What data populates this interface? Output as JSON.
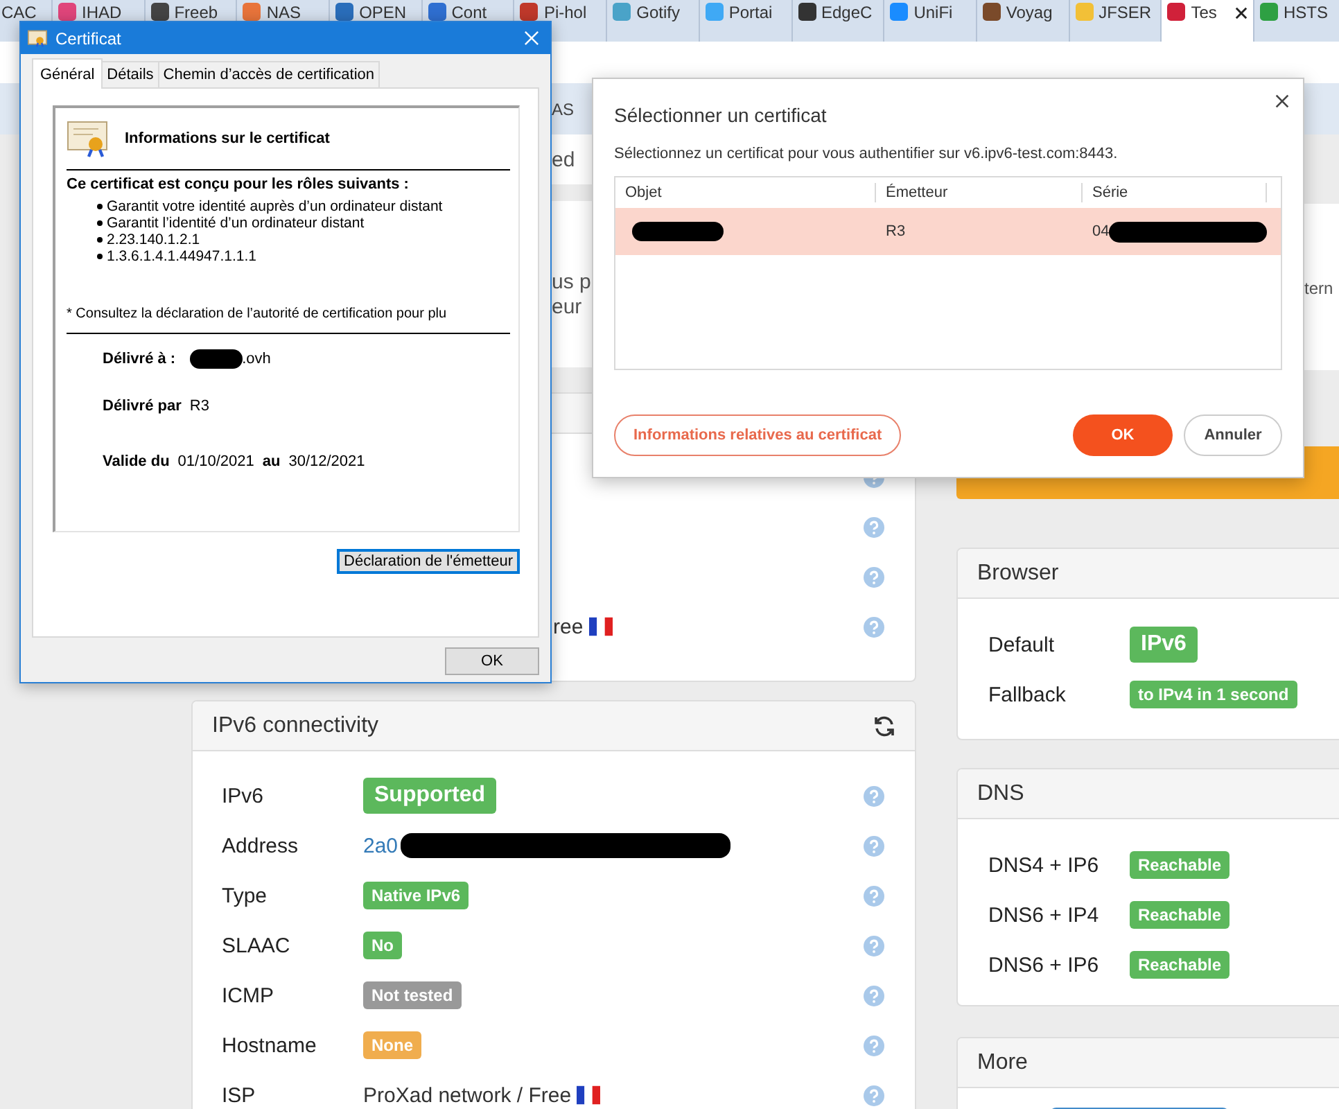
{
  "browser_tabs": [
    {
      "label": "CAC",
      "selected": false
    },
    {
      "label": "IHAD",
      "color": "#e0457b",
      "selected": false
    },
    {
      "label": "Freeb",
      "color": "#444444",
      "selected": false
    },
    {
      "label": "NAS",
      "color": "#e8743b",
      "selected": false
    },
    {
      "label": "OPEN",
      "color": "#2a6ebb",
      "selected": false
    },
    {
      "label": "Cont",
      "color": "#2f6fd1",
      "selected": false
    },
    {
      "label": "Pi-hol",
      "color": "#c0392b",
      "selected": false
    },
    {
      "label": "Gotify",
      "color": "#4aa3c8",
      "selected": false
    },
    {
      "label": "Portai",
      "color": "#3fa9f5",
      "selected": false
    },
    {
      "label": "EdgeC",
      "color": "#333333",
      "selected": false
    },
    {
      "label": "UniFi",
      "color": "#1a8cff",
      "selected": false
    },
    {
      "label": "Voyag",
      "color": "#7a4a2a",
      "selected": false
    },
    {
      "label": "JFSER",
      "color": "#f2c037",
      "selected": false
    },
    {
      "label": "Tes",
      "color": "#d0213a",
      "selected": true
    },
    {
      "label": "HSTS",
      "color": "#2ea043",
      "selected": false
    }
  ],
  "page_fragments": {
    "nav": "AS",
    "notice": "ed",
    "intro_lines": [
      "us p",
      "eur"
    ],
    "side_text": "tern"
  },
  "upper_card": {
    "isp_fragment": "ree"
  },
  "ipv6_card": {
    "title": "IPv6 connectivity",
    "rows": [
      {
        "label": "IPv6",
        "kind": "badge-large",
        "value": "Supported",
        "color": "#5cb85c"
      },
      {
        "label": "Address",
        "kind": "link",
        "value": "2a0",
        "redacted": true
      },
      {
        "label": "Type",
        "kind": "badge",
        "value": "Native IPv6",
        "color": "#5cb85c"
      },
      {
        "label": "SLAAC",
        "kind": "badge",
        "value": "No",
        "color": "#5cb85c"
      },
      {
        "label": "ICMP",
        "kind": "badge",
        "value": "Not tested",
        "color": "#999999"
      },
      {
        "label": "Hostname",
        "kind": "badge",
        "value": "None",
        "color": "#f0ad4e"
      },
      {
        "label": "ISP",
        "kind": "text-flag",
        "value": "ProXad network / Free"
      }
    ]
  },
  "browser_card": {
    "title": "Browser",
    "rows": [
      {
        "label": "Default",
        "kind": "badge-large",
        "value": "IPv6",
        "color": "#5cb85c"
      },
      {
        "label": "Fallback",
        "kind": "badge",
        "value": "to IPv4 in 1 second",
        "color": "#5cb85c"
      }
    ]
  },
  "dns_card": {
    "title": "DNS",
    "rows": [
      {
        "label": "DNS4 + IP6",
        "kind": "badge",
        "value": "Reachable",
        "color": "#5cb85c"
      },
      {
        "label": "DNS6 + IP4",
        "kind": "badge",
        "value": "Reachable",
        "color": "#5cb85c"
      },
      {
        "label": "DNS6 + IP6",
        "kind": "badge",
        "value": "Reachable",
        "color": "#5cb85c"
      }
    ]
  },
  "more_card": {
    "title": "More"
  },
  "cert_window": {
    "title": "Certificat",
    "tabs": [
      {
        "label": "Général",
        "selected": true
      },
      {
        "label": "Détails",
        "selected": false
      },
      {
        "label": "Chemin d’accès de certification",
        "selected": false
      }
    ],
    "heading": "Informations sur le certificat",
    "purpose_heading": "Ce certificat est conçu pour les rôles suivants :",
    "purposes": [
      "Garantit votre identité auprès d’un ordinateur distant",
      "Garantit l’identité d’un ordinateur distant",
      "2.23.140.1.2.1",
      "1.3.6.1.4.1.44947.1.1.1"
    ],
    "footnote": "* Consultez la déclaration de l’autorité de certification pour plu",
    "issued_to_label": "Délivré à :",
    "issued_to": ".ovh",
    "issued_by_label": "Délivré par",
    "issued_by": "R3",
    "valid_from_label": "Valide du",
    "valid_from": "01/10/2021",
    "valid_to_label": "au",
    "valid_to": "30/12/2021",
    "statement_button": "Déclaration de l'émetteur",
    "ok_button": "OK"
  },
  "select_dialog": {
    "title": "Sélectionner un certificat",
    "message": "Sélectionnez un certificat pour vous authentifier sur v6.ipv6-test.com:8443.",
    "columns": [
      "Objet",
      "Émetteur",
      "Série"
    ],
    "rows": [
      {
        "issuer": "R3",
        "serial": "04",
        "selected": true
      }
    ],
    "info_button": "Informations relatives au certificat",
    "ok_button": "OK",
    "cancel_button": "Annuler"
  }
}
